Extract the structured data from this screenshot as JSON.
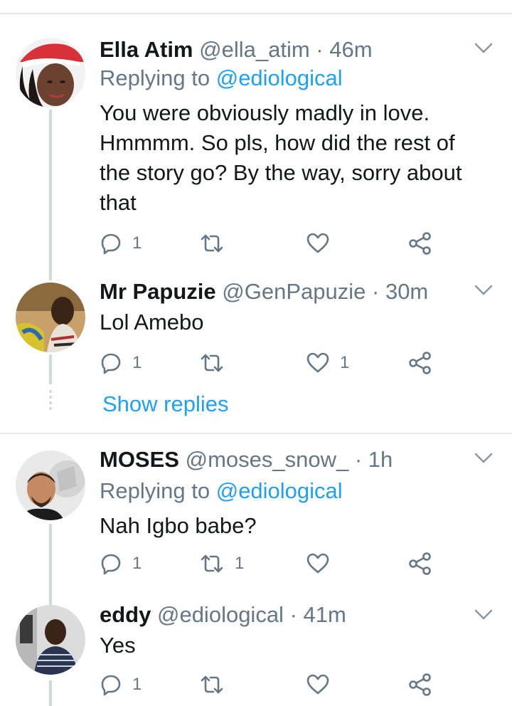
{
  "tweets": [
    {
      "name": "Ella Atim",
      "handle": "@ella_atim",
      "time": "46m",
      "replying_prefix": "Replying to",
      "replying_to": "@ediological",
      "text": "You were obviously madly in love. Hmmmm. So pls, how did the rest of the story go? By the way, sorry about that",
      "reply_count": "1",
      "retweet_count": "",
      "like_count": ""
    },
    {
      "name": "Mr Papuzie",
      "handle": "@GenPapuzie",
      "time": "30m",
      "text": "Lol Amebo",
      "reply_count": "1",
      "retweet_count": "",
      "like_count": "1",
      "show_replies": "Show replies"
    },
    {
      "name": "MOSES",
      "handle": "@moses_snow_",
      "time": "1h",
      "replying_prefix": "Replying to",
      "replying_to": "@ediological",
      "text": "Nah Igbo babe?",
      "reply_count": "1",
      "retweet_count": "1",
      "like_count": ""
    },
    {
      "name": "eddy",
      "handle": "@ediological",
      "time": "41m",
      "text": "Yes",
      "reply_count": "1",
      "retweet_count": "",
      "like_count": ""
    }
  ],
  "separator": "·",
  "colors": {
    "text_primary": "#14171a",
    "text_secondary": "#657786",
    "link_blue": "#1da1f2",
    "divider": "#e6ecf0",
    "thread_line": "#cfd9de"
  },
  "icons": {
    "reply": "reply-icon",
    "retweet": "retweet-icon",
    "like": "heart-icon",
    "share": "share-icon",
    "more": "chevron-down-icon"
  }
}
